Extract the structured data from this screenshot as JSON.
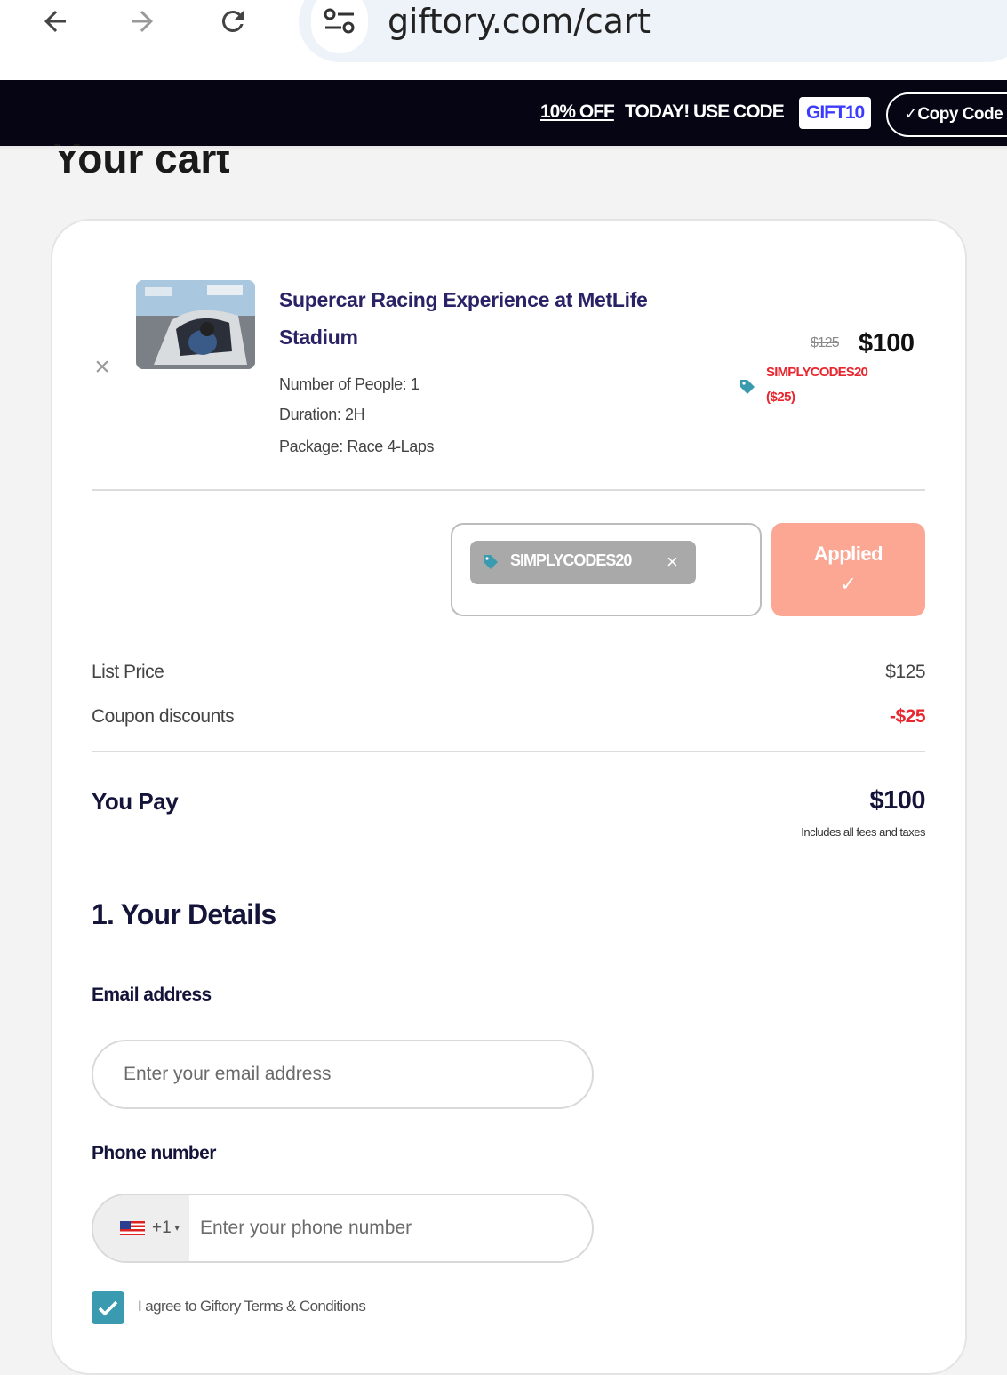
{
  "browser": {
    "back_icon": "arrow-left-icon",
    "forward_icon": "arrow-right-icon",
    "reload_icon": "reload-icon",
    "site_info_icon": "tune-icon",
    "url": "giftory.com/cart"
  },
  "promo": {
    "discount": "10% OFF",
    "text": "TODAY! USE CODE",
    "code": "GIFT10",
    "copy_label": "Copy Code"
  },
  "page": {
    "title": "Your cart"
  },
  "cart_item": {
    "title": "Supercar Racing Experience at MetLife Stadium",
    "people": "Number of People: 1",
    "duration": "Duration: 2H",
    "package": "Package: Race 4-Laps",
    "old_price": "$125",
    "price": "$100",
    "coupon_code": "SIMPLYCODES20",
    "coupon_savings": "($25)"
  },
  "coupon": {
    "chip_label": "SIMPLYCODES20",
    "applied_label": "Applied"
  },
  "summary": {
    "list_price_label": "List Price",
    "list_price_value": "$125",
    "discount_label": "Coupon discounts",
    "discount_value": "-$25",
    "pay_label": "You Pay",
    "pay_value": "$100",
    "fees_note": "Includes all fees and taxes"
  },
  "details": {
    "section_title": "1. Your Details",
    "email_label": "Email address",
    "email_placeholder": "Enter your email address",
    "phone_label": "Phone number",
    "country_code": "+1",
    "phone_placeholder": "Enter your phone number",
    "agree_text": "I agree to Giftory Terms & Conditions",
    "agree_checked": true
  },
  "colors": {
    "accent_teal": "#3a9bb0",
    "applied_salmon": "#fba793",
    "discount_red": "#e8262e",
    "promo_bg": "#050514"
  }
}
